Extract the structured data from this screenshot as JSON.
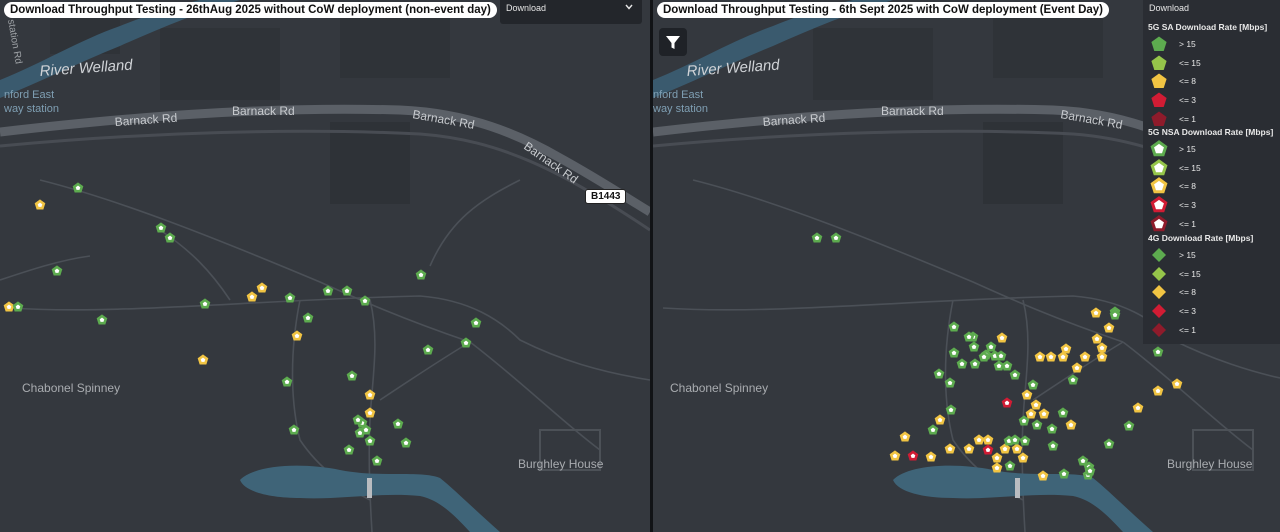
{
  "left_panel": {
    "title": "Download Throughput Testing - 26thAug 2025 without CoW deployment (non-event day)",
    "dropdown_label": "Download",
    "road_label": "B1443"
  },
  "right_panel": {
    "title": "Download Throughput Testing - 6th Sept 2025 with CoW deployment (Event Day)"
  },
  "map_labels": {
    "river": "River Welland",
    "barnack": "Barnack Rd",
    "spinney": "Chabonel Spinney",
    "burghley": "Burghley House",
    "station_top": "nford East",
    "station_bottom": "way station",
    "station_left_edge": "station Rd"
  },
  "legend": {
    "title": "Download",
    "sections": [
      {
        "name": "5G SA Download Rate [Mbps]",
        "shape": "pentagon-filled",
        "items": [
          {
            "label": "> 15",
            "color": "#5dab4f"
          },
          {
            "label": "<= 15",
            "color": "#95c54a"
          },
          {
            "label": "<= 8",
            "color": "#f1c443"
          },
          {
            "label": "<= 3",
            "color": "#d11c34"
          },
          {
            "label": "<= 1",
            "color": "#8e1b2b"
          }
        ]
      },
      {
        "name": "5G NSA Download Rate [Mbps]",
        "shape": "pentagon-outline",
        "items": [
          {
            "label": "> 15",
            "color": "#5dab4f"
          },
          {
            "label": "<= 15",
            "color": "#95c54a"
          },
          {
            "label": "<= 8",
            "color": "#f1c443"
          },
          {
            "label": "<= 3",
            "color": "#d11c34"
          },
          {
            "label": "<= 1",
            "color": "#8e1b2b"
          }
        ]
      },
      {
        "name": "4G Download Rate [Mbps]",
        "shape": "diamond",
        "items": [
          {
            "label": "> 15",
            "color": "#5dab4f"
          },
          {
            "label": "<= 15",
            "color": "#95c54a"
          },
          {
            "label": "<= 8",
            "color": "#f1c443"
          },
          {
            "label": "<= 3",
            "color": "#d11c34"
          },
          {
            "label": "<= 1",
            "color": "#8e1b2b"
          }
        ]
      }
    ]
  },
  "measurements": {
    "left": [
      {
        "lvl": "g"
      },
      {
        "lvl": "y"
      },
      {
        "lvl": "g"
      },
      {
        "lvl": "g"
      },
      {
        "lvl": "g"
      },
      {
        "lvl": "y"
      },
      {
        "lvl": "g"
      },
      {
        "lvl": "g"
      },
      {
        "lvl": "g"
      },
      {
        "lvl": "y"
      },
      {
        "lvl": "y"
      },
      {
        "lvl": "g"
      },
      {
        "lvl": "g"
      },
      {
        "lvl": "g"
      },
      {
        "lvl": "g"
      },
      {
        "lvl": "g"
      },
      {
        "lvl": "g"
      },
      {
        "lvl": "y"
      },
      {
        "lvl": "g"
      },
      {
        "lvl": "y"
      },
      {
        "lvl": "g"
      },
      {
        "lvl": "y"
      },
      {
        "lvl": "g"
      },
      {
        "lvl": "g"
      },
      {
        "lvl": "g"
      },
      {
        "lvl": "y"
      },
      {
        "lvl": "g"
      },
      {
        "lvl": "g"
      },
      {
        "lvl": "g"
      },
      {
        "lvl": "g"
      },
      {
        "lvl": "g"
      },
      {
        "lvl": "g"
      },
      {
        "lvl": "g"
      },
      {
        "lvl": "g"
      },
      {
        "lvl": "g"
      },
      {
        "lvl": "g"
      }
    ],
    "right": [
      {
        "lvl": "g"
      },
      {
        "lvl": "g"
      },
      {
        "lvl": "g"
      },
      {
        "lvl": "g"
      },
      {
        "lvl": "g"
      },
      {
        "lvl": "g"
      },
      {
        "lvl": "g"
      },
      {
        "lvl": "g"
      },
      {
        "lvl": "g"
      },
      {
        "lvl": "g"
      },
      {
        "lvl": "g"
      },
      {
        "lvl": "g"
      },
      {
        "lvl": "g"
      },
      {
        "lvl": "g"
      },
      {
        "lvl": "g"
      },
      {
        "lvl": "g"
      },
      {
        "lvl": "g"
      },
      {
        "lvl": "g"
      },
      {
        "lvl": "g"
      },
      {
        "lvl": "y"
      },
      {
        "lvl": "y"
      },
      {
        "lvl": "y"
      },
      {
        "lvl": "y"
      },
      {
        "lvl": "y"
      },
      {
        "lvl": "y"
      },
      {
        "lvl": "y"
      },
      {
        "lvl": "y"
      },
      {
        "lvl": "y"
      },
      {
        "lvl": "y"
      },
      {
        "lvl": "y"
      },
      {
        "lvl": "y"
      },
      {
        "lvl": "y"
      },
      {
        "lvl": "y"
      },
      {
        "lvl": "y"
      },
      {
        "lvl": "y"
      },
      {
        "lvl": "y"
      },
      {
        "lvl": "y"
      },
      {
        "lvl": "y"
      },
      {
        "lvl": "y"
      },
      {
        "lvl": "y"
      },
      {
        "lvl": "y"
      },
      {
        "lvl": "y"
      },
      {
        "lvl": "y"
      },
      {
        "lvl": "y"
      },
      {
        "lvl": "y"
      },
      {
        "lvl": "y"
      },
      {
        "lvl": "y"
      },
      {
        "lvl": "y"
      },
      {
        "lvl": "y"
      },
      {
        "lvl": "r"
      },
      {
        "lvl": "r"
      },
      {
        "lvl": "r"
      },
      {
        "lvl": "g"
      },
      {
        "lvl": "g"
      },
      {
        "lvl": "g"
      },
      {
        "lvl": "g"
      },
      {
        "lvl": "g"
      },
      {
        "lvl": "g"
      },
      {
        "lvl": "g"
      },
      {
        "lvl": "g"
      },
      {
        "lvl": "g"
      },
      {
        "lvl": "g"
      },
      {
        "lvl": "g"
      },
      {
        "lvl": "g"
      },
      {
        "lvl": "g"
      },
      {
        "lvl": "g"
      },
      {
        "lvl": "g"
      },
      {
        "lvl": "g"
      },
      {
        "lvl": "y"
      },
      {
        "lvl": "y"
      },
      {
        "lvl": "y"
      },
      {
        "lvl": "y"
      },
      {
        "lvl": "g"
      },
      {
        "lvl": "g"
      },
      {
        "lvl": "g"
      },
      {
        "lvl": "g"
      },
      {
        "lvl": "g"
      },
      {
        "lvl": "g"
      },
      {
        "lvl": "g"
      },
      {
        "lvl": "y"
      }
    ]
  },
  "colors": {
    "green": "#5dab4f",
    "lightgreen": "#95c54a",
    "yellow": "#f1c443",
    "red": "#d11c34",
    "darkred": "#8e1b2b",
    "water": "#3f6478",
    "road": "#555a61"
  }
}
